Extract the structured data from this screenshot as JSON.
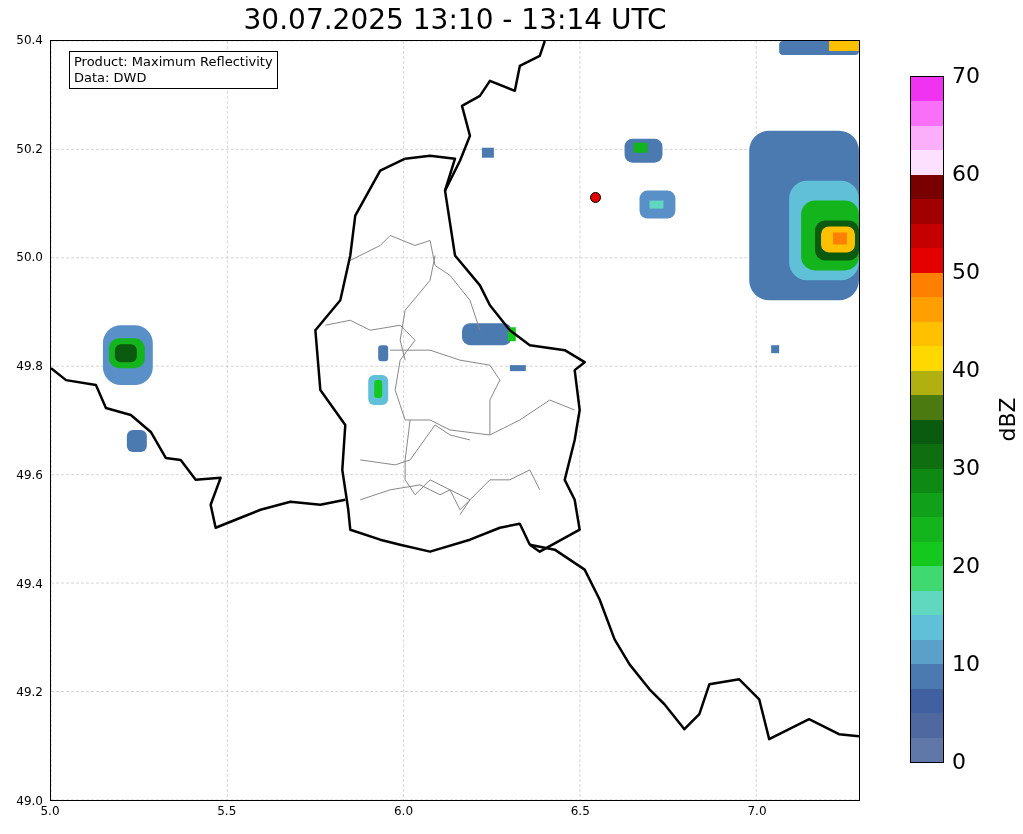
{
  "title": "30.07.2025 13:10 - 13:14 UTC",
  "map": {
    "info_lines": [
      "Product: Maximum Reflectivity",
      "Data: DWD"
    ],
    "x_ticks": [
      "5.0",
      "5.5",
      "6.0",
      "6.5",
      "7.0"
    ],
    "y_ticks": [
      "50.4",
      "50.2",
      "50.0",
      "49.8",
      "49.6",
      "49.4",
      "49.2",
      "49.0"
    ]
  },
  "colorbar": {
    "label": "dBZ",
    "ticks": [
      "70",
      "60",
      "50",
      "40",
      "30",
      "20",
      "10",
      "0"
    ],
    "bands": [
      {
        "color": "#f033f0"
      },
      {
        "color": "#f870f8"
      },
      {
        "color": "#fbaffb"
      },
      {
        "color": "#fde0fd"
      },
      {
        "color": "#780000"
      },
      {
        "color": "#a00000"
      },
      {
        "color": "#c40000"
      },
      {
        "color": "#e40000"
      },
      {
        "color": "#ff8000"
      },
      {
        "color": "#ffa000"
      },
      {
        "color": "#ffc000"
      },
      {
        "color": "#ffd800"
      },
      {
        "color": "#b0b010"
      },
      {
        "color": "#4a7a10"
      },
      {
        "color": "#0a5a10"
      },
      {
        "color": "#0e6e10"
      },
      {
        "color": "#0e8a14"
      },
      {
        "color": "#10a01a"
      },
      {
        "color": "#14b41c"
      },
      {
        "color": "#14c81e"
      },
      {
        "color": "#40d870"
      },
      {
        "color": "#60d8c0"
      },
      {
        "color": "#60c0d8"
      },
      {
        "color": "#5aa0c8"
      },
      {
        "color": "#4a7ab0"
      },
      {
        "color": "#4060a0"
      },
      {
        "color": "#5068a0"
      },
      {
        "color": "#6078a8"
      }
    ]
  }
}
